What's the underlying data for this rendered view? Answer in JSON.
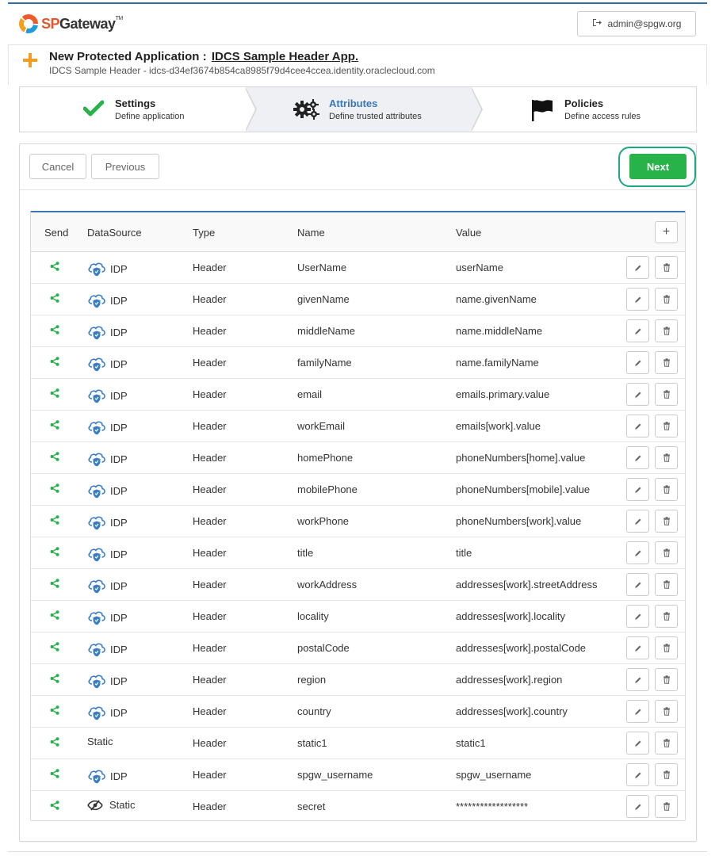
{
  "header": {
    "logo_sp": "SP",
    "logo_rest": "Gateway",
    "logo_tm": "TM",
    "user_label": "admin@spgw.org"
  },
  "title": {
    "prefix": "New Protected Application :",
    "app_name": "IDCS Sample Header App.",
    "subtitle": "IDCS Sample Header - idcs-d34ef3674b854ca8985f79d4cee4ccea.identity.oraclecloud.com"
  },
  "wizard": {
    "steps": [
      {
        "label": "Settings",
        "desc": "Define application"
      },
      {
        "label": "Attributes",
        "desc": "Define trusted attributes"
      },
      {
        "label": "Policies",
        "desc": "Define access rules"
      }
    ]
  },
  "toolbar": {
    "cancel_label": "Cancel",
    "previous_label": "Previous",
    "next_label": "Next"
  },
  "colors": {
    "accent_blue": "#3a76b8",
    "next_green": "#27b24a",
    "highlight_ring": "#1aa781",
    "share_green": "#27b24a",
    "cloud_blue": "#3a7fc1"
  },
  "table": {
    "headers": {
      "send": "Send",
      "datasource": "DataSource",
      "type": "Type",
      "name": "Name",
      "value": "Value"
    },
    "add_symbol": "+",
    "rows": [
      {
        "ds": "IDP",
        "ds_icon": "cloud-shield-icon",
        "type": "Header",
        "name": "UserName",
        "value": "userName"
      },
      {
        "ds": "IDP",
        "ds_icon": "cloud-shield-icon",
        "type": "Header",
        "name": "givenName",
        "value": "name.givenName"
      },
      {
        "ds": "IDP",
        "ds_icon": "cloud-shield-icon",
        "type": "Header",
        "name": "middleName",
        "value": "name.middleName"
      },
      {
        "ds": "IDP",
        "ds_icon": "cloud-shield-icon",
        "type": "Header",
        "name": "familyName",
        "value": "name.familyName"
      },
      {
        "ds": "IDP",
        "ds_icon": "cloud-shield-icon",
        "type": "Header",
        "name": "email",
        "value": "emails.primary.value"
      },
      {
        "ds": "IDP",
        "ds_icon": "cloud-shield-icon",
        "type": "Header",
        "name": "workEmail",
        "value": "emails[work].value"
      },
      {
        "ds": "IDP",
        "ds_icon": "cloud-shield-icon",
        "type": "Header",
        "name": "homePhone",
        "value": "phoneNumbers[home].value"
      },
      {
        "ds": "IDP",
        "ds_icon": "cloud-shield-icon",
        "type": "Header",
        "name": "mobilePhone",
        "value": "phoneNumbers[mobile].value"
      },
      {
        "ds": "IDP",
        "ds_icon": "cloud-shield-icon",
        "type": "Header",
        "name": "workPhone",
        "value": "phoneNumbers[work].value"
      },
      {
        "ds": "IDP",
        "ds_icon": "cloud-shield-icon",
        "type": "Header",
        "name": "title",
        "value": "title"
      },
      {
        "ds": "IDP",
        "ds_icon": "cloud-shield-icon",
        "type": "Header",
        "name": "workAddress",
        "value": "addresses[work].streetAddress"
      },
      {
        "ds": "IDP",
        "ds_icon": "cloud-shield-icon",
        "type": "Header",
        "name": "locality",
        "value": "addresses[work].locality"
      },
      {
        "ds": "IDP",
        "ds_icon": "cloud-shield-icon",
        "type": "Header",
        "name": "postalCode",
        "value": "addresses[work].postalCode"
      },
      {
        "ds": "IDP",
        "ds_icon": "cloud-shield-icon",
        "type": "Header",
        "name": "region",
        "value": "addresses[work].region"
      },
      {
        "ds": "IDP",
        "ds_icon": "cloud-shield-icon",
        "type": "Header",
        "name": "country",
        "value": "addresses[work].country"
      },
      {
        "ds": "Static",
        "ds_icon": "",
        "type": "Header",
        "name": "static1",
        "value": "static1"
      },
      {
        "ds": "IDP",
        "ds_icon": "cloud-shield-icon",
        "type": "Header",
        "name": "spgw_username",
        "value": "spgw_username"
      },
      {
        "ds": "Static",
        "ds_icon": "eye-slash-icon",
        "type": "Header",
        "name": "secret",
        "value": "******************"
      }
    ]
  }
}
